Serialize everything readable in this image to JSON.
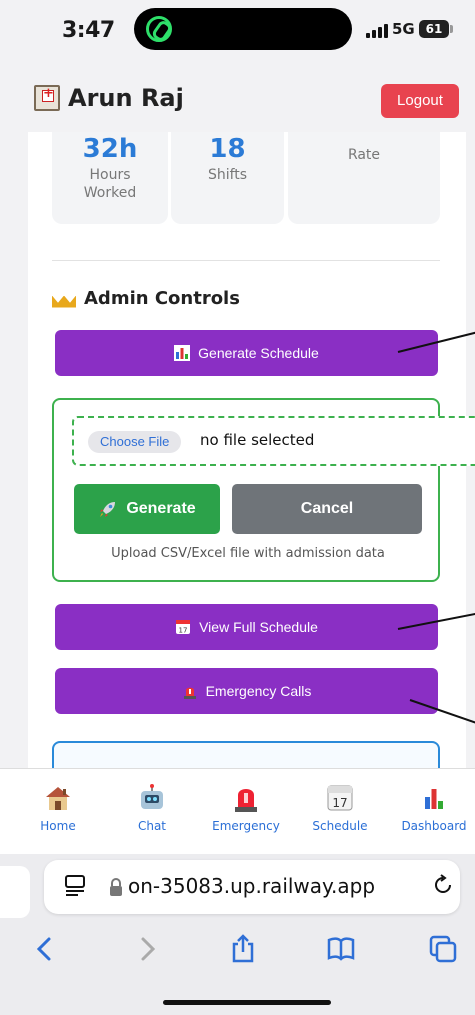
{
  "status_bar": {
    "time": "3:47",
    "network": "5G",
    "battery": "61"
  },
  "header": {
    "title": "Arun Raj",
    "logout_label": "Logout"
  },
  "stats": {
    "hours_value": "32h",
    "hours_label_line1": "Hours",
    "hours_label_line2": "Worked",
    "shifts_value": "18",
    "shifts_label": "Shifts",
    "rate_label": "Rate"
  },
  "admin": {
    "title": "Admin Controls",
    "generate_schedule_label": "Generate Schedule",
    "choose_file_label": "Choose File",
    "file_status": "no file selected",
    "generate_label": "Generate",
    "cancel_label": "Cancel",
    "upload_hint": "Upload CSV/Excel file with admission data",
    "view_schedule_label": "View Full Schedule",
    "emergency_calls_label": "Emergency Calls"
  },
  "tabs": [
    {
      "label": "Home",
      "icon": "house-icon"
    },
    {
      "label": "Chat",
      "icon": "robot-icon"
    },
    {
      "label": "Emergency",
      "icon": "siren-icon"
    },
    {
      "label": "Schedule",
      "icon": "calendar-icon"
    },
    {
      "label": "Dashboard",
      "icon": "bar-chart-icon"
    }
  ],
  "schedule_tab_day": "17",
  "view_schedule_icon_day": "17",
  "browser": {
    "url": "on-35083.up.railway.app"
  },
  "colors": {
    "accent_purple": "#8a2fc4",
    "logout_red": "#e8434f",
    "generate_green": "#2ca24a",
    "cancel_gray": "#6f7479",
    "stat_blue": "#2b7bd6",
    "tab_blue": "#2b6fd6"
  }
}
